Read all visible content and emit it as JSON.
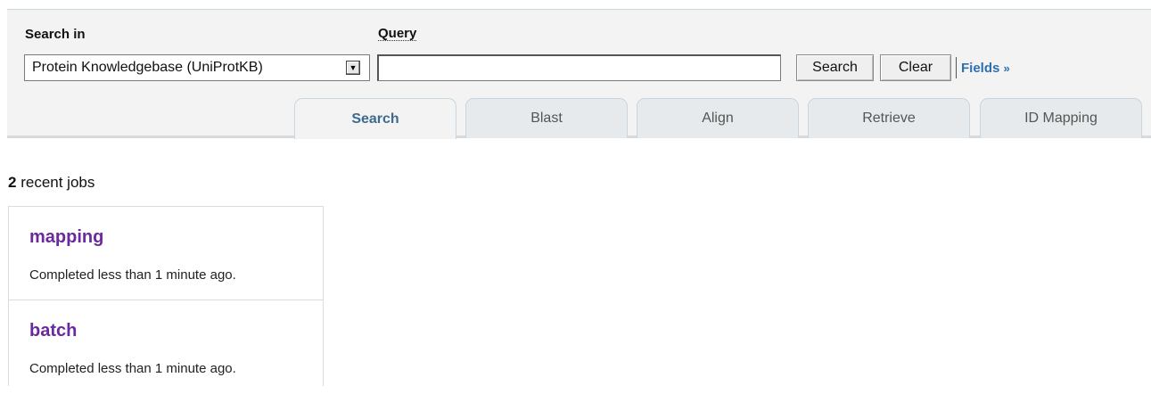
{
  "search_form": {
    "search_in_label": "Search in",
    "query_label": "Query",
    "database_selected": "Protein Knowledgebase (UniProtKB)",
    "query_value": "",
    "search_button": "Search",
    "clear_button": "Clear",
    "fields_link": "Fields",
    "fields_link_suffix": "»"
  },
  "tabs": [
    {
      "label": "Search",
      "active": true
    },
    {
      "label": "Blast",
      "active": false
    },
    {
      "label": "Align",
      "active": false
    },
    {
      "label": "Retrieve",
      "active": false
    },
    {
      "label": "ID Mapping",
      "active": false
    }
  ],
  "recent_jobs": {
    "count": "2",
    "label": "recent jobs",
    "items": [
      {
        "name": "mapping",
        "status": "Completed less than 1 minute ago."
      },
      {
        "name": "batch",
        "status": "Completed less than 1 minute ago."
      }
    ]
  },
  "colors": {
    "link_blue": "#2e6fb0",
    "job_purple": "#6a2a9e",
    "active_tab_text": "#3d6a8e"
  },
  "icons": {
    "select_arrow": "dropdown-arrow-icon"
  }
}
